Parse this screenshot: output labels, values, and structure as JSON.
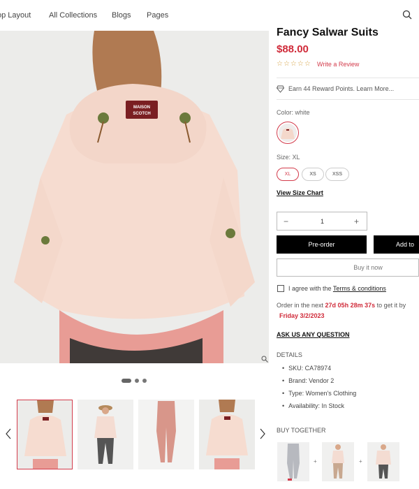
{
  "nav": {
    "items": [
      "op Layout",
      "All Collections",
      "Blogs",
      "Pages"
    ]
  },
  "product": {
    "title": "Fancy Salwar Suits",
    "price": "$88.00",
    "rating_stars": "☆☆☆☆☆",
    "write_review": "Write a Review",
    "reward_text": "Earn 44 Reward Points.  Learn More...",
    "color_label": "Color: white",
    "size_label": "Size: XL",
    "sizes": [
      "XL",
      "XS",
      "XSS"
    ],
    "selected_size": "XL",
    "size_chart": "View Size Chart",
    "quantity": "1",
    "preorder_label": "Pre-order",
    "add_label": "Add to",
    "buy_now_label": "Buy it now",
    "agree_prefix": "I agree with the ",
    "agree_link": "Terms & conditions",
    "order_prefix": "Order in the next ",
    "order_countdown": "27d 05h 28m 37s",
    "order_suffix": " to get it by",
    "order_date": "Friday 3/2/2023",
    "ask_question": "ASK US ANY QUESTION",
    "details_title": "DETAILS",
    "details": [
      "SKU: CA78974",
      "Brand: Vendor 2",
      "Type: Women's Clothing",
      "Availability: In Stock"
    ],
    "buy_together_title": "BUY TOGETHER"
  },
  "gallery": {
    "active_thumb": 1,
    "thumb_count": 4
  },
  "colors": {
    "accent": "#d02b3a",
    "button_dark": "#000000",
    "jacket": "#f4dcd2"
  }
}
